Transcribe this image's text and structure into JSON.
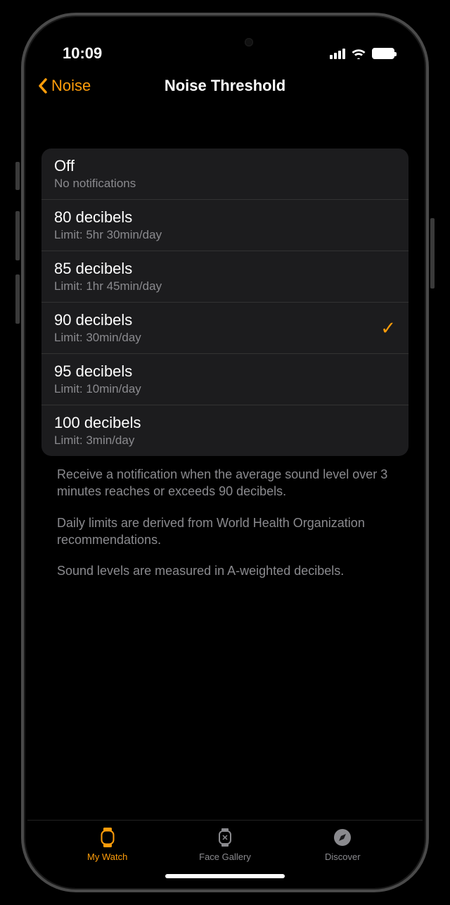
{
  "status": {
    "time": "10:09"
  },
  "nav": {
    "back": "Noise",
    "title": "Noise Threshold"
  },
  "options": [
    {
      "title": "Off",
      "sub": "No notifications",
      "selected": false
    },
    {
      "title": "80 decibels",
      "sub": "Limit: 5hr 30min/day",
      "selected": false
    },
    {
      "title": "85 decibels",
      "sub": "Limit: 1hr 45min/day",
      "selected": false
    },
    {
      "title": "90 decibels",
      "sub": "Limit: 30min/day",
      "selected": true
    },
    {
      "title": "95 decibels",
      "sub": "Limit: 10min/day",
      "selected": false
    },
    {
      "title": "100 decibels",
      "sub": "Limit: 3min/day",
      "selected": false
    }
  ],
  "footer": {
    "p1": "Receive a notification when the average sound level over 3 minutes reaches or exceeds 90 decibels.",
    "p2": "Daily limits are derived from World Health Organization recommendations.",
    "p3": "Sound levels are measured in A-weighted decibels."
  },
  "tabs": {
    "mywatch": "My Watch",
    "facegallery": "Face Gallery",
    "discover": "Discover"
  }
}
